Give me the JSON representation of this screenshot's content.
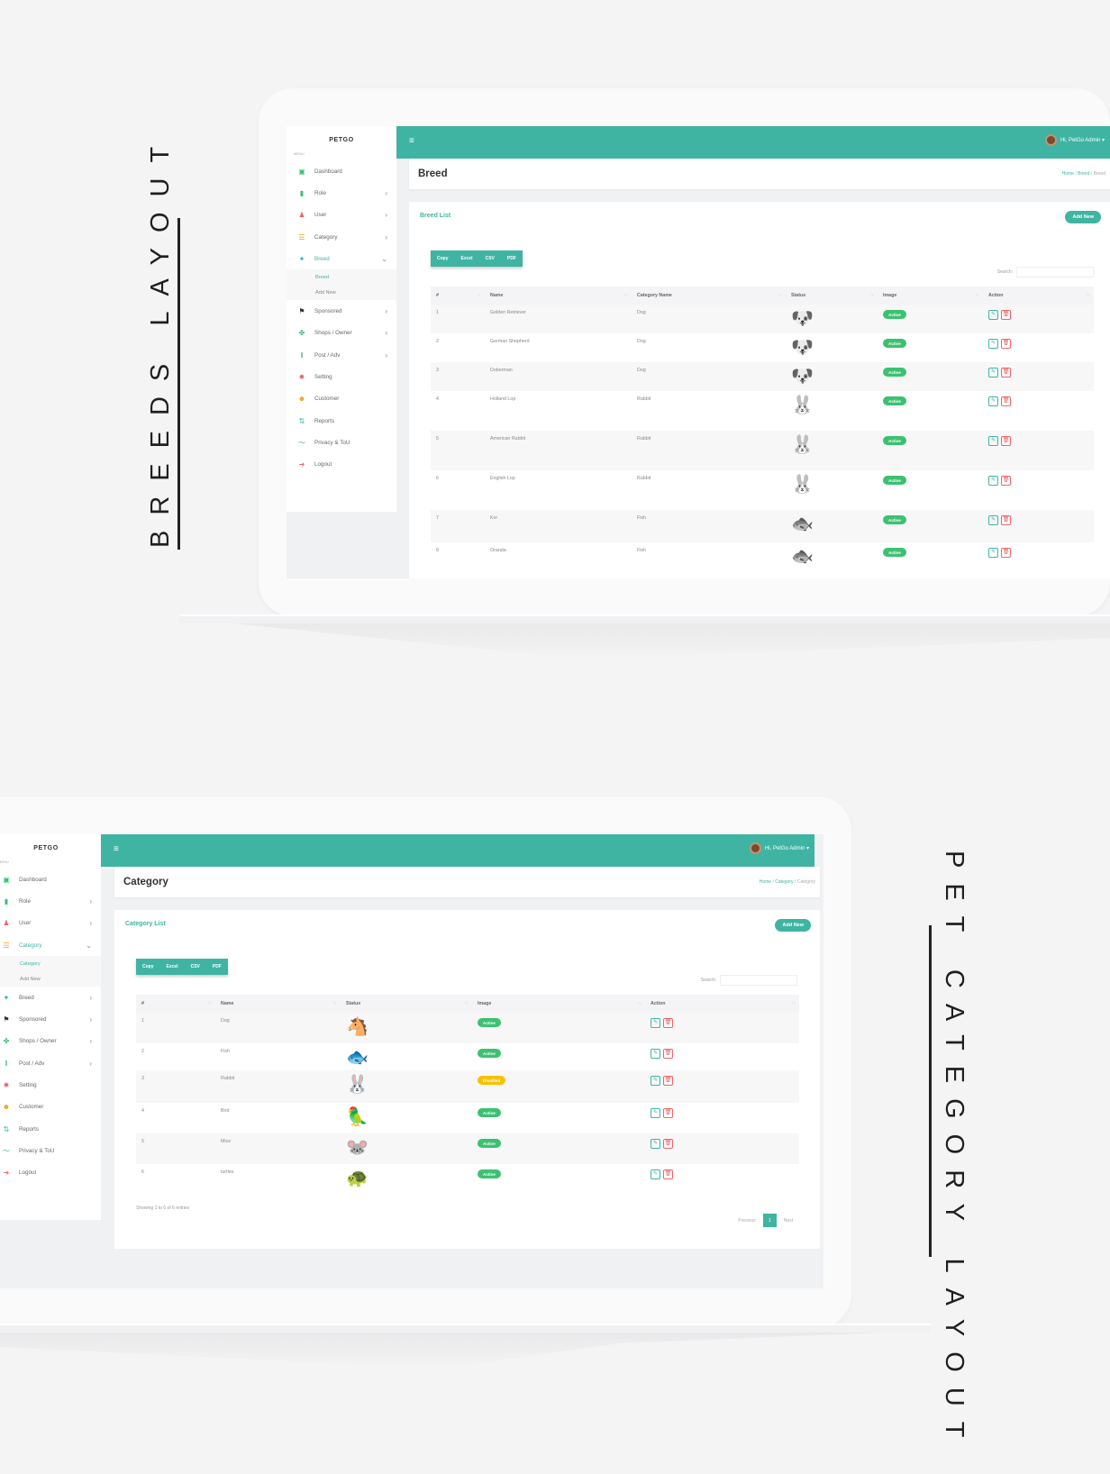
{
  "labels": {
    "breeds": "BREEDS LAYOUT",
    "category": "PET CATEGORY LAYOUT"
  },
  "common": {
    "brand": "PETGO",
    "menu_heading": "MENU",
    "admin": "Hi, PetGo Admin",
    "add_new": "Add New",
    "search_label": "Search:",
    "export_buttons": [
      "Copy",
      "Excel",
      "CSV",
      "PDF"
    ],
    "status_active": "Active",
    "status_disabled": "Disabled",
    "colors": {
      "accent": "#3fb4a3",
      "active": "#3cc171",
      "disabled": "#f9c100",
      "danger": "#e66666"
    }
  },
  "breed_menu": [
    {
      "label": "Dashboard",
      "icon": "dashboard-icon",
      "chev": ""
    },
    {
      "label": "Role",
      "icon": "role-icon",
      "chev": "›"
    },
    {
      "label": "User",
      "icon": "user-icon",
      "chev": "›"
    },
    {
      "label": "Category",
      "icon": "category-icon",
      "chev": "›"
    },
    {
      "label": "Breed",
      "icon": "bird-icon",
      "chev": "⌄"
    },
    {
      "label": "Sponsored",
      "icon": "sponsored-icon",
      "chev": "›"
    },
    {
      "label": "Shops / Owner",
      "icon": "paw-icon",
      "chev": "›"
    },
    {
      "label": "Post / Adv",
      "icon": "post-icon",
      "chev": "›"
    },
    {
      "label": "Setting",
      "icon": "gear-icon",
      "chev": ""
    },
    {
      "label": "Customer",
      "icon": "customer-icon",
      "chev": ""
    },
    {
      "label": "Reports",
      "icon": "reports-icon",
      "chev": ""
    },
    {
      "label": "Privacy & ToU",
      "icon": "privacy-icon",
      "chev": ""
    },
    {
      "label": "Logout",
      "icon": "logout-icon",
      "chev": ""
    }
  ],
  "breed_submenu": [
    "Breed",
    "Add New"
  ],
  "category_menu": [
    {
      "label": "Dashboard",
      "chev": ""
    },
    {
      "label": "Role",
      "chev": "›"
    },
    {
      "label": "User",
      "chev": "›"
    },
    {
      "label": "Category",
      "chev": "⌄"
    },
    {
      "label": "Breed",
      "chev": "›"
    },
    {
      "label": "Sponsored",
      "chev": "›"
    },
    {
      "label": "Shops / Owner",
      "chev": "›"
    },
    {
      "label": "Post / Adv",
      "chev": "›"
    },
    {
      "label": "Setting",
      "chev": ""
    },
    {
      "label": "Customer",
      "chev": ""
    },
    {
      "label": "Reports",
      "chev": ""
    },
    {
      "label": "Privacy & ToU",
      "chev": ""
    },
    {
      "label": "Logout",
      "chev": ""
    }
  ],
  "category_submenu": [
    "Category",
    "Add New"
  ],
  "breed_page": {
    "title": "Breed",
    "breadcrumb": [
      "Home",
      "Breed",
      "Breed"
    ],
    "list_title": "Breed List",
    "columns": [
      "#",
      "Name",
      "Category Name",
      "Status",
      "Image",
      "Action"
    ],
    "rows": [
      {
        "id": "1",
        "name": "Golden Retriever",
        "category": "Dog",
        "icon": "dog-icon"
      },
      {
        "id": "2",
        "name": "German Shepherd",
        "category": "Dog",
        "icon": "dog-icon"
      },
      {
        "id": "3",
        "name": "Doberman",
        "category": "Dog",
        "icon": "dog-icon"
      },
      {
        "id": "4",
        "name": "Holland Lop",
        "category": "Rabbit",
        "icon": "rabbit-icon"
      },
      {
        "id": "5",
        "name": "American Rabbit",
        "category": "Rabbit",
        "icon": "rabbit-icon"
      },
      {
        "id": "6",
        "name": "English Lop",
        "category": "Rabbit",
        "icon": "rabbit-icon"
      },
      {
        "id": "7",
        "name": "Koi",
        "category": "Fish",
        "icon": "fish-icon"
      },
      {
        "id": "8",
        "name": "Oranda",
        "category": "Fish",
        "icon": "fish-icon"
      }
    ]
  },
  "category_page": {
    "title": "Category",
    "breadcrumb": [
      "Home",
      "Category",
      "Category"
    ],
    "list_title": "Category List",
    "columns": [
      "#",
      "Name",
      "Status",
      "Image",
      "Action"
    ],
    "rows": [
      {
        "id": "1",
        "name": "Dog",
        "icon": "horse-icon",
        "status": "Active"
      },
      {
        "id": "2",
        "name": "Fish",
        "icon": "fish-icon",
        "status": "Active"
      },
      {
        "id": "3",
        "name": "Rabbit",
        "icon": "rabbit-icon",
        "status": "Disabled"
      },
      {
        "id": "4",
        "name": "Bird",
        "icon": "parrot-icon",
        "status": "Active"
      },
      {
        "id": "5",
        "name": "Mice",
        "icon": "mouse-icon",
        "status": "Active"
      },
      {
        "id": "6",
        "name": "turtles",
        "icon": "turtle-icon",
        "status": "Active"
      }
    ],
    "showing": "Showing 1 to 6 of 6 entries",
    "pagination": {
      "previous": "Previous",
      "current": "1",
      "next": "Next"
    }
  }
}
